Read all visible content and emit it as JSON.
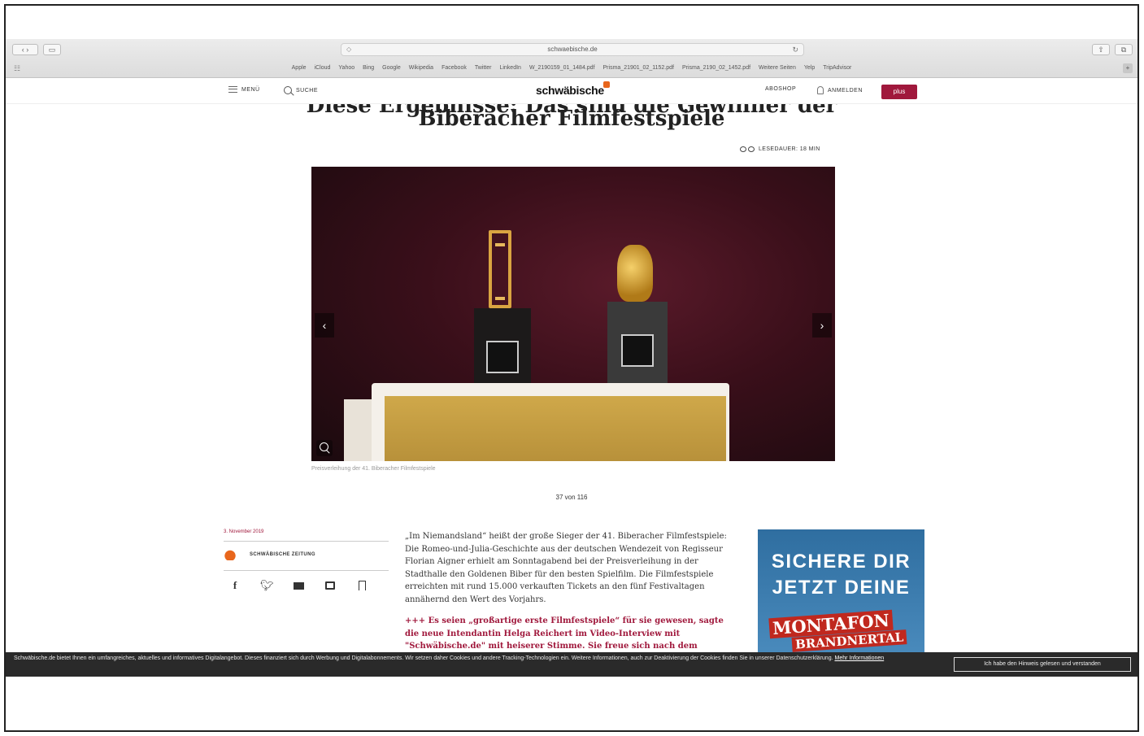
{
  "browser": {
    "url": "schwaebische.de",
    "bookmarks": [
      "Apple",
      "iCloud",
      "Yahoo",
      "Bing",
      "Google",
      "Wikipedia",
      "Facebook",
      "Twitter",
      "LinkedIn",
      "W_2190159_01_1484.pdf",
      "Prisma_21901_02_1152.pdf",
      "Prisma_2190_02_1452.pdf",
      "Weitere Seiten",
      "Yelp",
      "TripAdvisor"
    ]
  },
  "site": {
    "menu_label": "MENÜ",
    "search_label": "SUCHE",
    "logo": "schwäbische",
    "aboshop_label": "ABOSHOP",
    "login_label": "ANMELDEN",
    "plus_label": "plus"
  },
  "article": {
    "headline_top": "Diese Ergebnisse: Das sind die Gewinner der",
    "headline": "Biberacher Filmfestspiele",
    "read_time": "LESEDAUER: 18 MIN",
    "gallery": {
      "caption": "Preisverleihung der 41. Biberacher Filmfestspiele",
      "counter": "37 von 116",
      "prev": "‹",
      "next": "›"
    },
    "date": "3. November 2019",
    "publisher": "SCHWÄBISCHE ZEITUNG",
    "body": "„Im Niemandsland“ heißt der große Sieger der 41. Biberacher Filmfestspiele: Die Romeo-und-Julia-Geschichte aus der deutschen Wendezeit von Regisseur Florian Aigner erhielt am Sonntagabend bei der Preisverleihung in der Stadthalle den Goldenen Biber für den besten Spielfilm. Die Filmfestspiele erreichten mit rund 15.000 verkauften Tickets an den fünf Festivaltagen annähernd den Wert des Vorjahrs.",
    "quote": "+++ Es seien „großartige erste Filmfestspiele“ für sie gewesen, sagte die neue Intendantin Helga Reichert im Video-Interview mit \"Schwäbische.de\" mit heiserer Stimme. Sie freue sich nach dem"
  },
  "ad": {
    "line1": "SICHERE DIR",
    "line2": "JETZT DEINE",
    "brand": "MONTAFON",
    "sub": "BRANDNERTAL"
  },
  "cookie": {
    "text": "Schwäbische.de bietet Ihnen ein umfangreiches, aktuelles und informatives Digitalangebot. Dieses finanziert sich durch Werbung und Digitalabonnements. Wir setzen daher Cookies und andere Tracking-Technologien ein. Weitere Informationen, auch zur Deaktivierung der Cookies finden Sie in unserer Datenschutzerklärung.",
    "more_link": "Mehr Informationen",
    "accept_button": "Ich habe den Hinweis gelesen und verstanden"
  },
  "colors": {
    "brand_red": "#a0183c",
    "brand_orange": "#e8661c",
    "ad_blue": "#3a7cb0"
  }
}
